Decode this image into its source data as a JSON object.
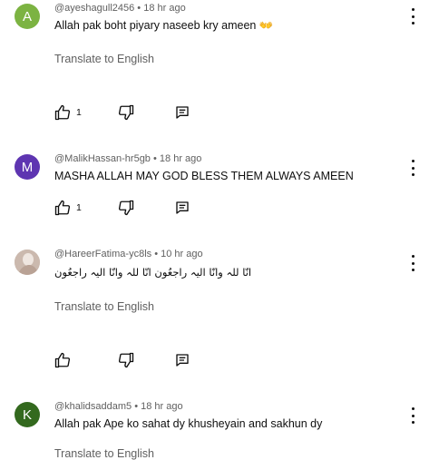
{
  "comments": [
    {
      "author": "@ayeshagull2456",
      "time": "18 hr ago",
      "text": "Allah pak boht piyary naseeb kry ameen",
      "emoji": "👐",
      "translate": "Translate to English",
      "likes": "1",
      "avatar_letter": "A",
      "avatar_color": "#7cb342",
      "icon": "hands-emoji"
    },
    {
      "author": "@MalikHassan-hr5gb",
      "time": "18 hr ago",
      "text": "MASHA ALLAH  MAY GOD BLESS THEM ALWAYS AMEEN",
      "likes": "1",
      "avatar_letter": "M",
      "avatar_color": "#5e35b1"
    },
    {
      "author": "@HareerFatima-yc8ls",
      "time": "10 hr ago",
      "text": "انّا للہ وانّا الیہ راجعُون  انّا للہ وانّا الیہ راجعُون",
      "translate": "Translate to English",
      "avatar_color": "#d7c8c0"
    },
    {
      "author": "@khalidsaddam5",
      "time": "18 hr ago",
      "text": "Allah  pak Ape ko sahat dy  khusheyain and  sakhun dy",
      "translate": "Translate to English",
      "avatar_letter": "K",
      "avatar_color": "#33691e"
    }
  ],
  "separator": " • "
}
